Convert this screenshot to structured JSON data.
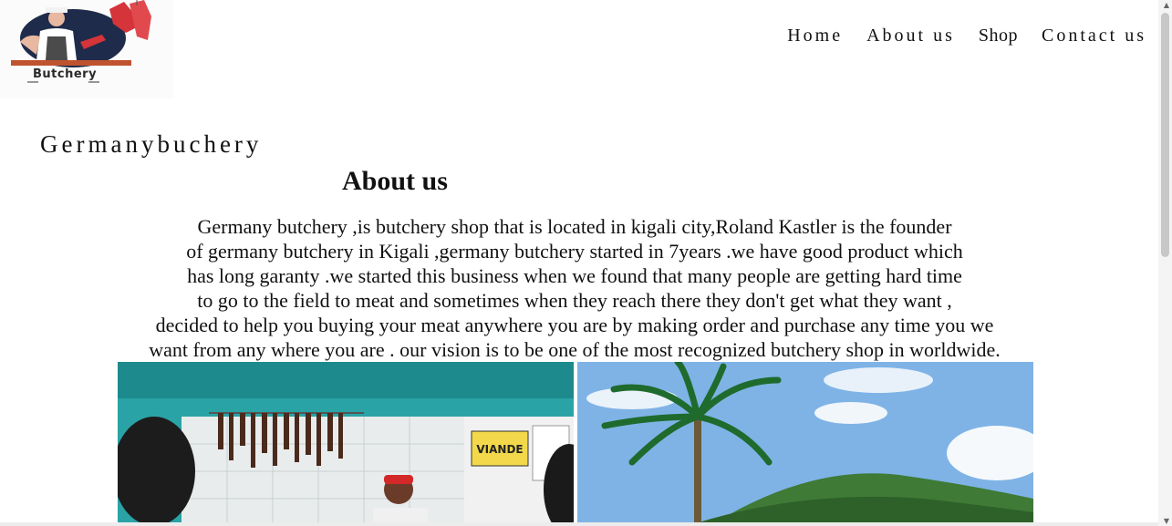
{
  "logo": {
    "title": "Butchery",
    "subtitle": "— Shop —"
  },
  "nav": [
    {
      "label": "Home"
    },
    {
      "label": "About us"
    },
    {
      "label": "Shop"
    },
    {
      "label": "Contact us"
    }
  ],
  "brand": "Germanybuchery",
  "about": {
    "heading": "About us",
    "lines": [
      "Germany butchery ,is butchery shop that is located in kigali city,Roland Kastler is the founder",
      "of germany butchery in Kigali ,germany butchery started in 7years .we have good product which",
      "has long garanty .we started this business when we found that many people are getting hard time",
      "to go to the field to meat and sometimes when they reach there they don't get what they want ,",
      "decided to help you buying your meat anywhere you are by making order and purchase any time you we",
      "want from any where you are . our vision is to be one of the most recognized butchery shop in worldwide."
    ]
  },
  "photos": {
    "left_sign": "VIANDE"
  }
}
